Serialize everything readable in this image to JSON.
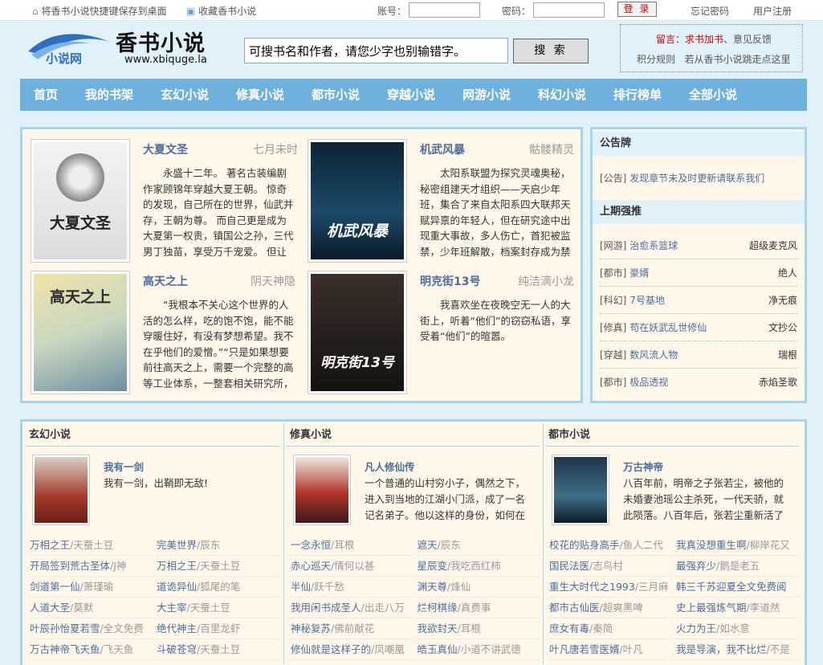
{
  "topbar": {
    "save_shortcut": "将香书小说快捷键保存到桌面",
    "bookmark": "收藏香书小说",
    "account_label": "账号：",
    "password_label": "密码：",
    "login_button": "登 录",
    "forgot_password": "忘记密码",
    "register": "用户注册"
  },
  "header": {
    "logo_small": "小说网",
    "site_name": "香书小说",
    "site_url": "www.xbiquge.la",
    "search_placeholder": "可搜书名和作者，请您少字也别输错字。",
    "search_button": "搜 索",
    "notice": {
      "label": "留言：",
      "link1": "求书加书",
      "sep": "、",
      "link2": "意见反馈",
      "link3": "积分规则",
      "link4": "若从香书小说跳走点这里"
    }
  },
  "nav": [
    "首页",
    "我的书架",
    "玄幻小说",
    "修真小说",
    "都市小说",
    "穿越小说",
    "网游小说",
    "科幻小说",
    "排行榜单",
    "全部小说"
  ],
  "featured": [
    {
      "title": "大夏文圣",
      "author": "七月未时",
      "cover": "大夏文圣",
      "intro": "永盛十二年。 著名古装编剧作家顾锦年穿越大夏王朝。 惊奇的发现，自己所在的世界，仙武并存，王朝为尊。 而自己更是成为大夏第一权贵，镇国公之孙，三代男丁独苗，享受万千宠爱。 但让顾锦年惊"
    },
    {
      "title": "机武风暴",
      "author": "骷髅精灵",
      "cover": "机武风暴",
      "intro": "太阳系联盟为探究灵魂奥秘，秘密组建天才组织——天启少年班，集合了来自太阳系四大联邦天赋异禀的年轻人，但在研究途中出现重大事故，多人伤亡，首犯被监禁，少年班解散，档案封存成为禁"
    },
    {
      "title": "高天之上",
      "author": "阴天神隐",
      "cover": "高天之上",
      "intro": "“我根本不关心这个世界的人活的怎么样，吃的饱不饱，能不能穿暖住好，有没有梦想希望。我不在乎他们的爱憎。”“只是如果想要前往高天之上，需要一个完整的高等工业体系，一整套相关研究所，最"
    },
    {
      "title": "明克街13号",
      "author": "纯洁滴小龙",
      "cover": "明克街13号",
      "intro": "我喜欢坐在夜晚空无一人的大街上，听着“他们”的窃窃私语，享受着“他们”的暄嚣。"
    }
  ],
  "sidebar": {
    "board_title": "公告牌",
    "announcement_tag": "[公告]",
    "announcement_text": "发现章节未及时更新请联系我们",
    "recommend_title": "上期强推",
    "recommend": [
      {
        "cat": "[网游]",
        "book": "治愈系篮球",
        "author": "超级麦克风"
      },
      {
        "cat": "[都市]",
        "book": "豪婿",
        "author": "绝人"
      },
      {
        "cat": "[科幻]",
        "book": "7号基地",
        "author": "净无痕"
      },
      {
        "cat": "[修真]",
        "book": "苟在妖武乱世修仙",
        "author": "文抄公"
      },
      {
        "cat": "[穿越]",
        "book": "数风流人物",
        "author": "瑞根"
      },
      {
        "cat": "[都市]",
        "book": "极品透视",
        "author": "赤焰圣歌"
      }
    ]
  },
  "categories": [
    {
      "name": "玄幻小说",
      "top": {
        "title": "我有一剑",
        "intro": "我有一剑，出鞘即无敌!"
      },
      "list": [
        [
          "万相之王",
          "/天蚕土豆"
        ],
        [
          "完美世界",
          "/辰东"
        ],
        [
          "开局签到荒古圣体",
          "/J神"
        ],
        [
          "万相之王",
          "/天蚕土豆"
        ],
        [
          "剑道第一仙",
          "/萧瑾瑜"
        ],
        [
          "道诡异仙",
          "/狐尾的笔"
        ],
        [
          "人道大圣",
          "/莫默"
        ],
        [
          "大主宰",
          "/天蚕土豆"
        ],
        [
          "叶辰孙怡夏若雪",
          "/全文免费"
        ],
        [
          "绝代神主",
          "/百里龙虾"
        ],
        [
          "万古神帝飞天鱼",
          "/飞天鱼"
        ],
        [
          "斗破苍穹",
          "/天蚕土豆"
        ]
      ]
    },
    {
      "name": "修真小说",
      "top": {
        "title": "凡人修仙传",
        "intro": "一个普通的山村穷小子，偶然之下，进入到当地的江湖小门派，成了一名记名弟子。他以这样的身份，如何在门派中立"
      },
      "list": [
        [
          "一念永恒",
          "/耳根"
        ],
        [
          "遮天",
          "/辰东"
        ],
        [
          "赤心巡天",
          "/情何以甚"
        ],
        [
          "星辰变",
          "/我吃西红柿"
        ],
        [
          "半仙",
          "/跃千愁"
        ],
        [
          "渊天尊",
          "/烽仙"
        ],
        [
          "我用闲书成圣人",
          "/出走八万"
        ],
        [
          "烂柯棋缘",
          "/真费事"
        ],
        [
          "神秘复苏",
          "/佛前献花"
        ],
        [
          "我欲封天",
          "/耳根"
        ],
        [
          "修仙就是这样子的",
          "/凤嘲凰"
        ],
        [
          "皓玉真仙",
          "/小道不讲武德"
        ]
      ]
    },
    {
      "name": "都市小说",
      "top": {
        "title": "万古神帝",
        "intro": "八百年前，明帝之子张若尘，被他的未婚妻池瑶公主杀死，一代天骄，就此陨落。八百年后，张若尘重新活了过来，却发现"
      },
      "list": [
        [
          "校花的贴身高手",
          "/鱼人二代"
        ],
        [
          "我真没想重生啊",
          "/柳岸花又"
        ],
        [
          "国民法医",
          "/志鸟村"
        ],
        [
          "最强弃少",
          "/鹅是老五"
        ],
        [
          "重生大时代之1993",
          "/三月麻"
        ],
        [
          "韩三千苏迎夏全文免费阅",
          ""
        ],
        [
          "都市古仙医",
          "/超爽黑啤"
        ],
        [
          "史上最强炼气期",
          "/李道然"
        ],
        [
          "庶女有毒",
          "/秦简"
        ],
        [
          "火力为王",
          "/如水意"
        ],
        [
          "叶凡唐若雪医婿",
          "/叶凡"
        ],
        [
          "我是导演，我不比烂",
          "/不是"
        ]
      ]
    }
  ]
}
